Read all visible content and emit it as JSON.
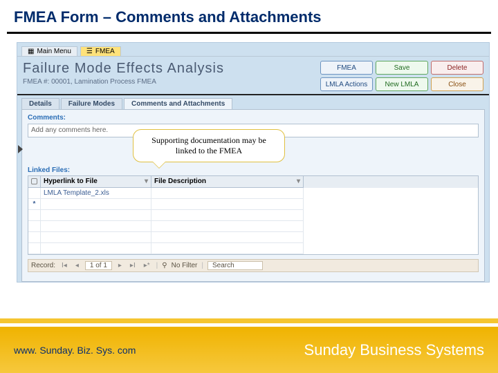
{
  "slide": {
    "title": "FMEA Form – Comments and Attachments"
  },
  "ribbon": {
    "main": "Main Menu",
    "fmea": "FMEA"
  },
  "form": {
    "title": "Failure Mode Effects Analysis",
    "subtitle": "FMEA #:  00001,  Lamination Process FMEA",
    "buttons": {
      "fmea": "FMEA",
      "save": "Save",
      "delete": "Delete",
      "actions": "LMLA Actions",
      "newlmla": "New LMLA",
      "close": "Close"
    }
  },
  "subtabs": {
    "details": "Details",
    "modes": "Failure Modes",
    "attach": "Comments and Attachments"
  },
  "comments": {
    "label": "Comments:",
    "value": "Add any comments here."
  },
  "callout": {
    "text": "Supporting documentation may be linked to the FMEA"
  },
  "linked": {
    "label": "Linked Files:",
    "headers": {
      "a": "Hyperlink to File",
      "b": "File Description"
    },
    "rows": [
      {
        "file": "LMLA Template_2.xls",
        "desc": ""
      }
    ],
    "newmark": "*"
  },
  "nav": {
    "label": "Record:",
    "first": "I◂",
    "prev": "◂",
    "pos": "1 of 1",
    "next": "▸",
    "last": "▸I",
    "new": "▸*",
    "nofilter": "No Filter",
    "search": "Search"
  },
  "footer": {
    "url": "www. Sunday. Biz. Sys. com",
    "brand": "Sunday Business Systems"
  }
}
